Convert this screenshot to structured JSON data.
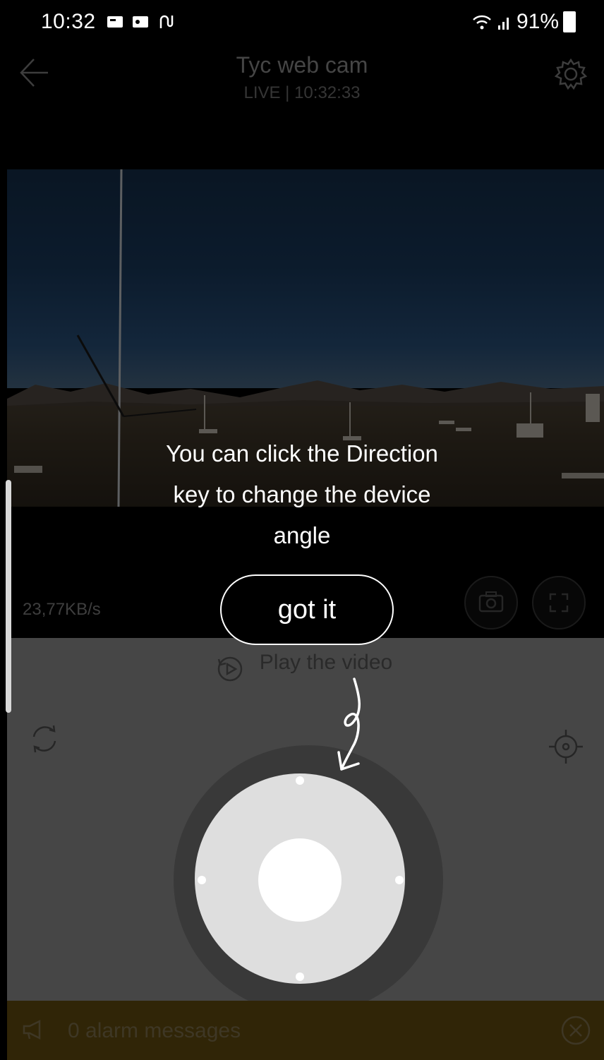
{
  "status_bar": {
    "time": "10:32",
    "battery": "91%",
    "icons": [
      "notification-icon",
      "notification-icon",
      "link-icon",
      "wifi-icon",
      "signal-icon",
      "battery-icon"
    ]
  },
  "header": {
    "title": "Tyc web cam",
    "subtitle": "LIVE | 10:32:33"
  },
  "player": {
    "bitrate": "23,77KB/s"
  },
  "tooltip": {
    "line1": "You can click the Direction",
    "line2": "key to change the device",
    "line3": "angle",
    "button": "got it"
  },
  "controls": {
    "play_label": "Play the video"
  },
  "alarm": {
    "text": "0 alarm messages"
  },
  "colors": {
    "panel_bg": "#9c9c9c",
    "alarm_bg": "#6b5210",
    "dpad": "#dedede"
  }
}
